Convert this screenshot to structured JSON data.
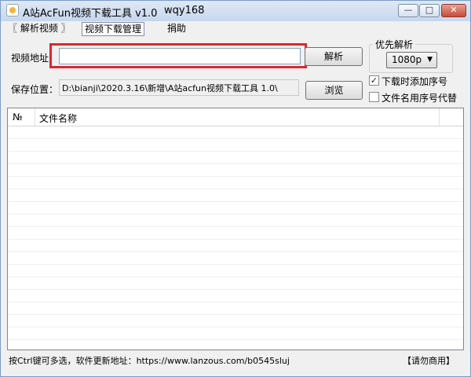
{
  "window": {
    "title": "A站AcFun视频下载工具 v1.0",
    "title_extra": "wqy168",
    "buttons": {
      "minimize": "—",
      "maximize": "□",
      "close": "✕"
    }
  },
  "tabs": [
    {
      "label": "〖 解析视频 〗"
    },
    {
      "label": "视频下载管理"
    },
    {
      "label": "捐助"
    }
  ],
  "parse": {
    "video_label": "视频地址：",
    "video_value": "",
    "parse_button": "解析",
    "priority_title": "优先解析",
    "priority_value": "1080p",
    "save_label": "保存位置：",
    "save_path": "D:\\bianji\\2020.3.16\\新增\\A站acfun视频下载工具 1.0\\",
    "browse_button": "浏览",
    "option1": {
      "label": "下载时添加序号",
      "checked": true
    },
    "option2": {
      "label": "文件名用序号代替",
      "checked": false
    }
  },
  "list": {
    "columns": [
      "№",
      "文件名称"
    ]
  },
  "status": {
    "left": "按Ctrl键可多选，软件更新地址：https://www.lanzous.com/b0545sluj",
    "right": "【请勿商用】"
  }
}
